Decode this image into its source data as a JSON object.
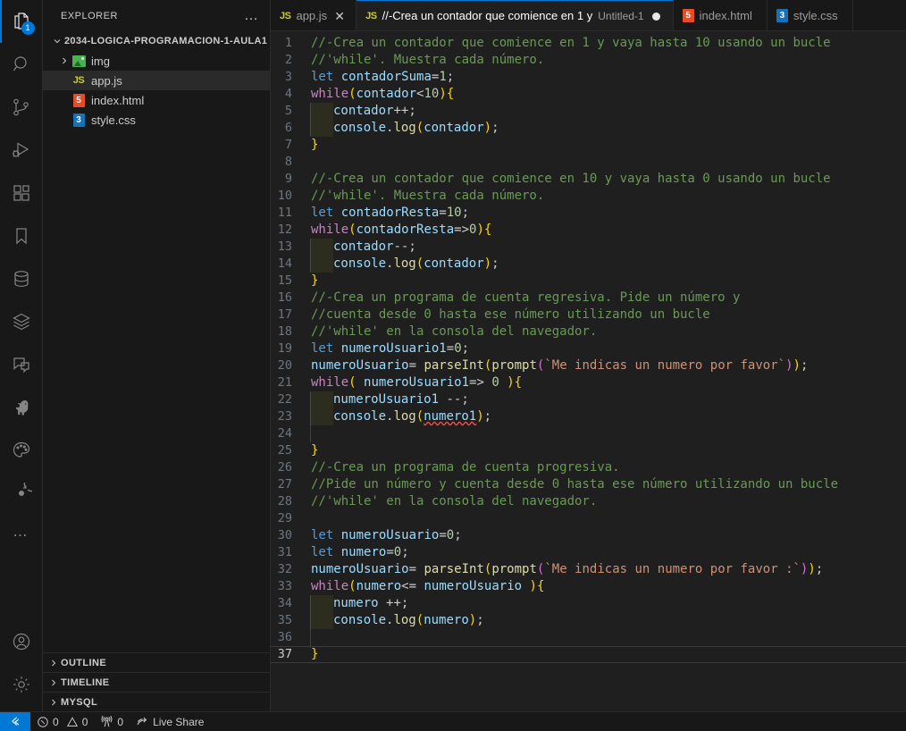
{
  "activitybar": {
    "items": [
      {
        "name": "explorer",
        "icon": "files-icon",
        "badge": "1",
        "active": true
      },
      {
        "name": "search",
        "icon": "search-icon",
        "badge": "",
        "active": false
      },
      {
        "name": "source-control",
        "icon": "source-control-icon",
        "badge": "",
        "active": false
      },
      {
        "name": "run-and-debug",
        "icon": "run-debug-icon",
        "badge": "",
        "active": false
      },
      {
        "name": "extensions",
        "icon": "extensions-icon",
        "badge": "",
        "active": false
      },
      {
        "name": "bookmarks",
        "icon": "bookmark-icon",
        "badge": "",
        "active": false
      },
      {
        "name": "database",
        "icon": "database-icon",
        "badge": "",
        "active": false
      },
      {
        "name": "layers",
        "icon": "layers-icon",
        "badge": "",
        "active": false
      },
      {
        "name": "remote-explorer",
        "icon": "screen-chat-icon",
        "badge": "",
        "active": false
      },
      {
        "name": "thunder-client",
        "icon": "dinosaur-icon",
        "badge": "",
        "active": false
      },
      {
        "name": "theme-palette",
        "icon": "palette-icon",
        "badge": "",
        "active": false
      },
      {
        "name": "target",
        "icon": "target-icon",
        "badge": "",
        "active": false
      },
      {
        "name": "more-actions",
        "icon": "ellipsis-icon",
        "badge": "",
        "active": false
      }
    ],
    "bottom": [
      {
        "name": "accounts",
        "icon": "account-icon"
      },
      {
        "name": "manage",
        "icon": "gear-icon"
      }
    ]
  },
  "sidebar": {
    "header_title": "EXPLORER",
    "more_actions": "…",
    "root_folder": "2034-LOGICA-PROGRAMACION-1-AULA1",
    "files": [
      {
        "label": "img",
        "icon": "image-folder-icon",
        "type": "folder",
        "selected": false
      },
      {
        "label": "app.js",
        "icon": "js-file-icon",
        "type": "file",
        "selected": true
      },
      {
        "label": "index.html",
        "icon": "html-file-icon",
        "type": "file",
        "selected": false
      },
      {
        "label": "style.css",
        "icon": "css-file-icon",
        "type": "file",
        "selected": false
      }
    ],
    "sections": [
      "OUTLINE",
      "TIMELINE",
      "MYSQL"
    ]
  },
  "tabs": [
    {
      "label": "app.js",
      "sublabel": "",
      "icon": "js-file-icon",
      "active": false,
      "dirty": false,
      "closable": true
    },
    {
      "label": "//-Crea un contador que comience en 1 y",
      "sublabel": "Untitled-1",
      "icon": "js-file-icon",
      "active": true,
      "dirty": true,
      "closable": false
    },
    {
      "label": "index.html",
      "sublabel": "",
      "icon": "html-file-icon",
      "active": false,
      "dirty": false,
      "closable": false
    },
    {
      "label": "style.css",
      "sublabel": "",
      "icon": "css-file-icon",
      "active": false,
      "dirty": false,
      "closable": false
    }
  ],
  "editor": {
    "active_line": 37,
    "total_lines": 37,
    "lines": [
      {
        "n": 1,
        "text": "//-Crea un contador que comience en 1 y vaya hasta 10 usando un bucle"
      },
      {
        "n": 2,
        "text": "//'while'. Muestra cada número."
      },
      {
        "n": 3,
        "text": "let contadorSuma=1;"
      },
      {
        "n": 4,
        "text": "while(contador<10){"
      },
      {
        "n": 5,
        "text": "    contador++;"
      },
      {
        "n": 6,
        "text": "    console.log(contador);"
      },
      {
        "n": 7,
        "text": "}"
      },
      {
        "n": 8,
        "text": ""
      },
      {
        "n": 9,
        "text": "//-Crea un contador que comience en 10 y vaya hasta 0 usando un bucle"
      },
      {
        "n": 10,
        "text": "//'while'. Muestra cada número."
      },
      {
        "n": 11,
        "text": "let contadorResta=10;"
      },
      {
        "n": 12,
        "text": "while(contadorResta=>0){"
      },
      {
        "n": 13,
        "text": "    contador--;"
      },
      {
        "n": 14,
        "text": "    console.log(contador);"
      },
      {
        "n": 15,
        "text": "}"
      },
      {
        "n": 16,
        "text": "//-Crea un programa de cuenta regresiva. Pide un número y"
      },
      {
        "n": 17,
        "text": "//cuenta desde 0 hasta ese número utilizando un bucle"
      },
      {
        "n": 18,
        "text": "//'while' en la consola del navegador."
      },
      {
        "n": 19,
        "text": "let numeroUsuario1=0;"
      },
      {
        "n": 20,
        "text": "numeroUsuario= parseInt(prompt(`Me indicas un numero por favor`));"
      },
      {
        "n": 21,
        "text": "while( numeroUsuario1=> 0 ){"
      },
      {
        "n": 22,
        "text": "    numeroUsuario1 --;"
      },
      {
        "n": 23,
        "text": "    console.log(numero1);"
      },
      {
        "n": 24,
        "text": ""
      },
      {
        "n": 25,
        "text": "}"
      },
      {
        "n": 26,
        "text": "//-Crea un programa de cuenta progresiva."
      },
      {
        "n": 27,
        "text": "//Pide un número y cuenta desde 0 hasta ese número utilizando un bucle"
      },
      {
        "n": 28,
        "text": "//'while' en la consola del navegador."
      },
      {
        "n": 29,
        "text": ""
      },
      {
        "n": 30,
        "text": "let numeroUsuario=0;"
      },
      {
        "n": 31,
        "text": "let numero=0;"
      },
      {
        "n": 32,
        "text": "numeroUsuario= parseInt(prompt(`Me indicas un numero por favor :`));"
      },
      {
        "n": 33,
        "text": "while(numero<= numeroUsuario ){"
      },
      {
        "n": 34,
        "text": "    numero ++;"
      },
      {
        "n": 35,
        "text": "    console.log(numero);"
      },
      {
        "n": 36,
        "text": ""
      },
      {
        "n": 37,
        "text": "}"
      }
    ]
  },
  "statusbar": {
    "remote_icon": "remote-window-icon",
    "errors_icon": "error-circle-icon",
    "errors": "0",
    "warnings_icon": "warning-triangle-icon",
    "warnings": "0",
    "ports_icon": "radio-tower-icon",
    "ports": "0",
    "liveshare_icon": "live-share-icon",
    "liveshare": "Live Share"
  },
  "colors": {
    "accent": "#0078d4",
    "activitybar_bg": "#181818",
    "sidebar_bg": "#181818",
    "editor_bg": "#1f1f1f",
    "comment": "#6a9955",
    "keyword": "#569cd6",
    "control": "#c586c0",
    "identifier": "#9cdcfe",
    "number": "#b5cea8",
    "function": "#dcdcaa",
    "string": "#ce9178",
    "bracket1": "#ffd700",
    "bracket2": "#da70d6",
    "bracket3": "#179fff",
    "error_squiggle": "#f14c4c"
  }
}
